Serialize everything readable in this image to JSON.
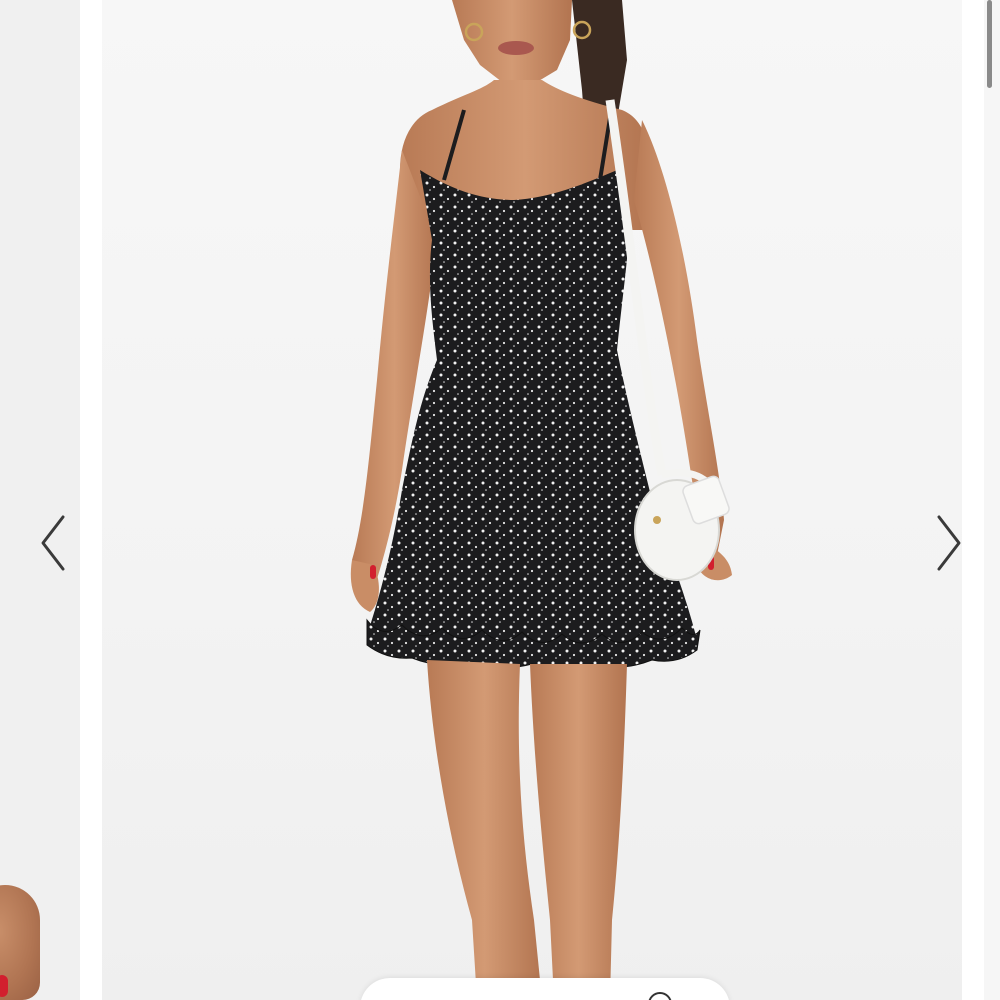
{
  "gallery": {
    "prev_icon": "chevron-left-icon",
    "next_icon": "chevron-right-icon",
    "colors": {
      "background": "#f6f6f6",
      "arrow": "#3a3a3a",
      "dress": "#1c1c1e",
      "bag": "#f4f4f2",
      "nail": "#d21f2e"
    }
  }
}
